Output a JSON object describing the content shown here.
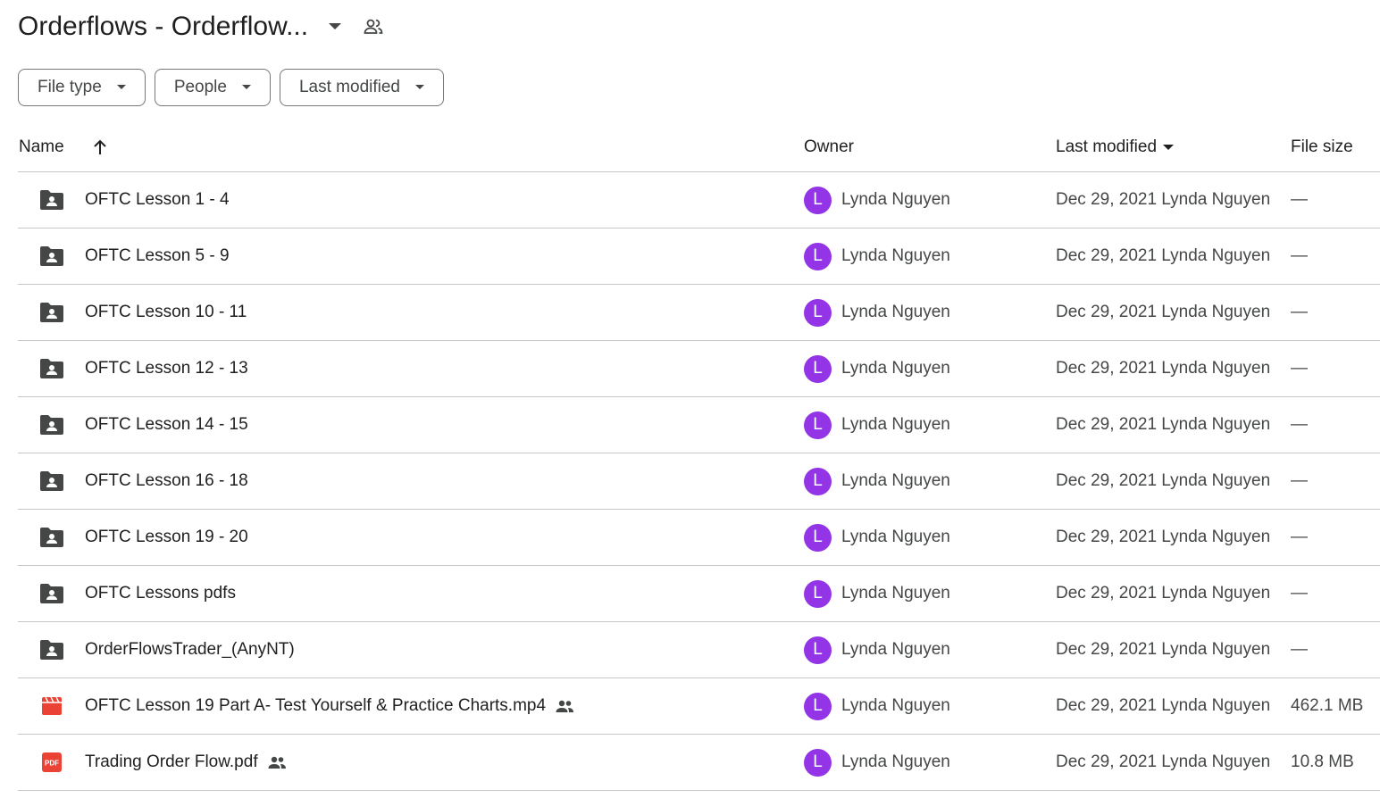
{
  "header": {
    "title": "Orderflows - Orderflow...",
    "caret_icon": "arrow-drop-down-icon",
    "shared_icon": "people-outline-icon"
  },
  "filters": [
    {
      "label": "File type"
    },
    {
      "label": "People"
    },
    {
      "label": "Last modified"
    }
  ],
  "columns": {
    "name": "Name",
    "owner": "Owner",
    "modified": "Last modified",
    "size": "File size"
  },
  "colors": {
    "avatar": "#9334e6",
    "folder": "#444746",
    "video": "#ea4335",
    "pdf": "#ea4335"
  },
  "files": [
    {
      "type": "shared-folder",
      "name": "OFTC Lesson 1 - 4",
      "shared": false,
      "owner_initial": "L",
      "owner": "Lynda Nguyen",
      "modified": "Dec 29, 2021 Lynda Nguyen",
      "size": "—"
    },
    {
      "type": "shared-folder",
      "name": "OFTC Lesson 5 - 9",
      "shared": false,
      "owner_initial": "L",
      "owner": "Lynda Nguyen",
      "modified": "Dec 29, 2021 Lynda Nguyen",
      "size": "—"
    },
    {
      "type": "shared-folder",
      "name": "OFTC Lesson 10 - 11",
      "shared": false,
      "owner_initial": "L",
      "owner": "Lynda Nguyen",
      "modified": "Dec 29, 2021 Lynda Nguyen",
      "size": "—"
    },
    {
      "type": "shared-folder",
      "name": "OFTC Lesson 12 - 13",
      "shared": false,
      "owner_initial": "L",
      "owner": "Lynda Nguyen",
      "modified": "Dec 29, 2021 Lynda Nguyen",
      "size": "—"
    },
    {
      "type": "shared-folder",
      "name": "OFTC Lesson 14 - 15",
      "shared": false,
      "owner_initial": "L",
      "owner": "Lynda Nguyen",
      "modified": "Dec 29, 2021 Lynda Nguyen",
      "size": "—"
    },
    {
      "type": "shared-folder",
      "name": "OFTC Lesson 16 - 18",
      "shared": false,
      "owner_initial": "L",
      "owner": "Lynda Nguyen",
      "modified": "Dec 29, 2021 Lynda Nguyen",
      "size": "—"
    },
    {
      "type": "shared-folder",
      "name": "OFTC Lesson 19 - 20",
      "shared": false,
      "owner_initial": "L",
      "owner": "Lynda Nguyen",
      "modified": "Dec 29, 2021 Lynda Nguyen",
      "size": "—"
    },
    {
      "type": "shared-folder",
      "name": "OFTC Lessons pdfs",
      "shared": false,
      "owner_initial": "L",
      "owner": "Lynda Nguyen",
      "modified": "Dec 29, 2021 Lynda Nguyen",
      "size": "—"
    },
    {
      "type": "shared-folder",
      "name": "OrderFlowsTrader_(AnyNT)",
      "shared": false,
      "owner_initial": "L",
      "owner": "Lynda Nguyen",
      "modified": "Dec 29, 2021 Lynda Nguyen",
      "size": "—"
    },
    {
      "type": "video",
      "name": "OFTC Lesson 19 Part A- Test Yourself & Practice Charts.mp4",
      "shared": true,
      "owner_initial": "L",
      "owner": "Lynda Nguyen",
      "modified": "Dec 29, 2021 Lynda Nguyen",
      "size": "462.1 MB"
    },
    {
      "type": "pdf",
      "name": "Trading Order Flow.pdf",
      "shared": true,
      "owner_initial": "L",
      "owner": "Lynda Nguyen",
      "modified": "Dec 29, 2021 Lynda Nguyen",
      "size": "10.8 MB"
    }
  ]
}
